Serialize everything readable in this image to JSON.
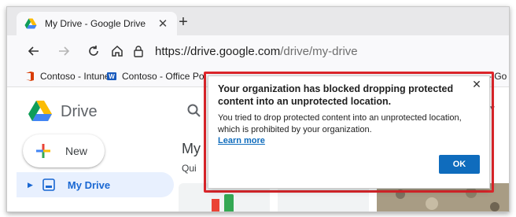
{
  "browser": {
    "tab_title": "My Drive - Google Drive",
    "url_host": "https://drive.google.com",
    "url_path": "/drive/my-drive",
    "favorites": [
      {
        "label": "Contoso - Intune",
        "icon": "office-icon"
      },
      {
        "label": "Contoso - Office Po...",
        "icon": "word-icon"
      },
      {
        "label": "- Go",
        "icon": "separator"
      }
    ]
  },
  "drive": {
    "app_name": "Drive",
    "new_label": "New",
    "nav_my_drive": "My Drive",
    "main_heading": "My",
    "main_sub": "Qui"
  },
  "dialog": {
    "title": "Your organization has blocked dropping protected content into an unprotected location.",
    "body": "You tried to drop protected content into an unprotected location, which is prohibited by your organization.",
    "link": "Learn more",
    "ok_label": "OK",
    "close_glyph": "✕"
  },
  "colors": {
    "highlight_border": "#e0262b",
    "ok_button": "#0f6cbd",
    "link": "#0f6cbd",
    "nav_active_bg": "#e8f0fe"
  }
}
